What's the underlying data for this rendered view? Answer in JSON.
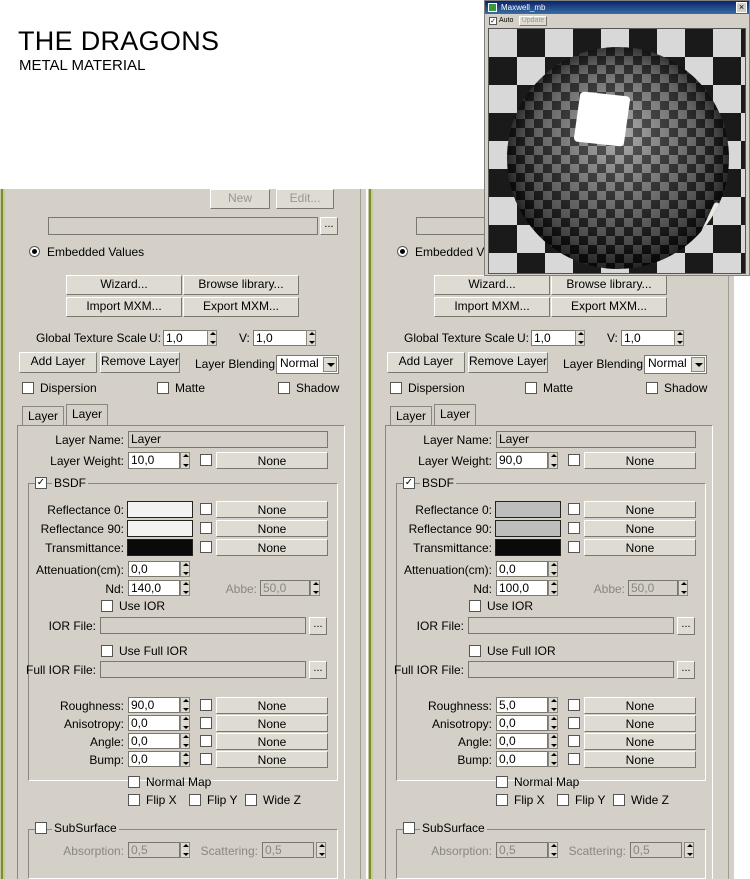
{
  "header": {
    "title": "THE DRAGONS",
    "subtitle": "METAL MATERIAL"
  },
  "viewer": {
    "title": "Maxwell_mb",
    "auto_label": "Auto",
    "update_label": "Update",
    "close": "×"
  },
  "common": {
    "new_label": "New",
    "edit_label": "Edit...",
    "browse_dots": "...",
    "embedded_values": "Embedded Values",
    "wizard": "Wizard...",
    "browse_library": "Browse library...",
    "import_mxm": "Import MXM...",
    "export_mxm": "Export MXM...",
    "global_texture_scale": "Global Texture Scale",
    "u_label": "U:",
    "v_label": "V:",
    "add_layer": "Add Layer",
    "remove_layer": "Remove Layer",
    "layer_blending": "Layer Blending:",
    "dispersion": "Dispersion",
    "matte": "Matte",
    "shadow": "Shadow",
    "layer_name_label": "Layer Name:",
    "layer_weight_label": "Layer Weight:",
    "none": "None",
    "bsdf": "BSDF",
    "reflectance0": "Reflectance 0:",
    "reflectance90": "Reflectance 90:",
    "transmittance": "Transmittance:",
    "attenuation": "Attenuation(cm):",
    "nd": "Nd:",
    "abbe": "Abbe:",
    "use_ior": "Use IOR",
    "ior_file": "IOR File:",
    "use_full_ior": "Use Full IOR",
    "full_ior_file": "Full IOR File:",
    "roughness": "Roughness:",
    "anisotropy": "Anisotropy:",
    "angle": "Angle:",
    "bump": "Bump:",
    "normal_map": "Normal Map",
    "flip_x": "Flip X",
    "flip_y": "Flip Y",
    "wide_z": "Wide Z",
    "subsurface": "SubSurface",
    "absorption": "Absorption:",
    "scattering": "Scattering:"
  },
  "panels": [
    {
      "u_value": "1,0",
      "v_value": "1,0",
      "blending": "Normal",
      "tabs": [
        "Layer",
        "Layer"
      ],
      "layer_name": "Layer",
      "layer_weight": "10,0",
      "refl0_color": "#f2f2f2",
      "refl90_color": "#f2f2f2",
      "trans_color": "#0a0a0a",
      "attenuation": "0,0",
      "nd": "140,0",
      "abbe": "50,0",
      "roughness": "90,0",
      "anisotropy": "0,0",
      "angle": "0,0",
      "bump": "0,0",
      "absorption": "0,5",
      "scattering": "0,5"
    },
    {
      "u_value": "1,0",
      "v_value": "1,0",
      "blending": "Normal",
      "tabs": [
        "Layer",
        "Layer"
      ],
      "layer_name": "Layer",
      "layer_weight": "90,0",
      "refl0_color": "#bdbdbd",
      "refl90_color": "#bdbdbd",
      "trans_color": "#0a0a0a",
      "attenuation": "0,0",
      "nd": "100,0",
      "abbe": "50,0",
      "roughness": "5,0",
      "anisotropy": "0,0",
      "angle": "0,0",
      "bump": "0,0",
      "absorption": "0,5",
      "scattering": "0,5"
    }
  ]
}
